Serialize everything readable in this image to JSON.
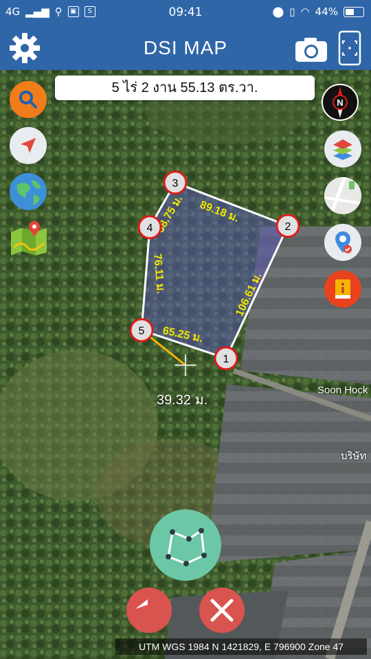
{
  "status_bar": {
    "network": "4G",
    "time": "09:41",
    "battery_percent": "44%"
  },
  "app_bar": {
    "title": "DSI MAP",
    "left_icon": "gear-icon",
    "right_icons": [
      "camera-icon",
      "phone-frame-icon"
    ]
  },
  "area_display": {
    "text": "5 ไร่ 2 งาน 55.13 ตร.วา."
  },
  "polygon": {
    "points": [
      {
        "label": "1"
      },
      {
        "label": "2"
      },
      {
        "label": "3"
      },
      {
        "label": "4"
      },
      {
        "label": "5"
      }
    ],
    "edge_lengths": {
      "edge_1_2": "106.61 ม.",
      "edge_2_3": "89.18 ม.",
      "edge_3_4": "38.75 ม.",
      "edge_4_5": "76.11 ม.",
      "edge_5_1": "65.25 ม."
    },
    "cursor_distance": "39.32 ม.",
    "line_color": "#ffffff",
    "fill_color": "#5a57b8",
    "edge_label_color": "#f3e600",
    "cursor_line_color": "#f2b400"
  },
  "map_labels": {
    "building_name": "Soon Hock",
    "thai_partial": "บริษัท"
  },
  "left_tools": [
    "search-icon",
    "navigate-arrow-icon",
    "globe-icon",
    "map-pin-icon"
  ],
  "right_tools": [
    "compass-icon",
    "layers-icon",
    "map-thumbnail-icon",
    "location-check-icon",
    "info-book-icon"
  ],
  "bottom_actions": {
    "draw_polygon_icon": "polygon-draw-icon",
    "undo_icon": "undo-icon",
    "cancel_icon": "close-icon",
    "draw_color": "#6cc7a6",
    "action_color": "#d9534f"
  },
  "utm_readout": "UTM WGS 1984 N 1421829, E 796900 Zone 47"
}
